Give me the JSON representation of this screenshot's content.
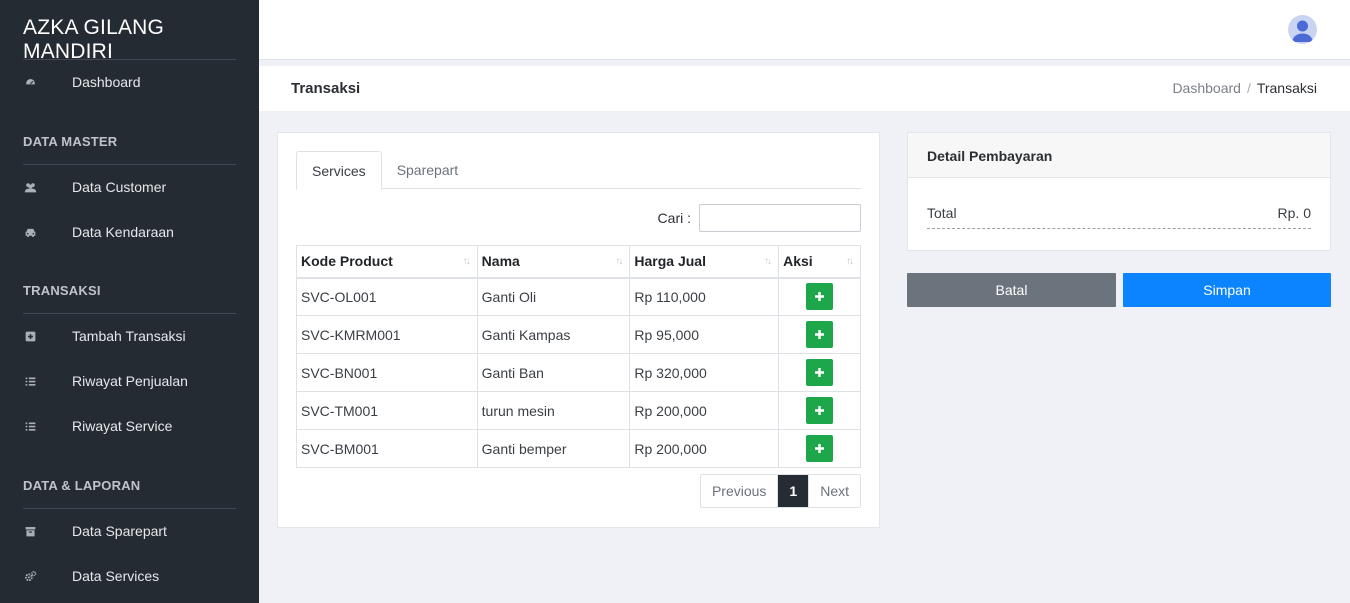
{
  "brand": "AZKA GILANG MANDIRI",
  "sidebar": {
    "dashboard": {
      "label": "Dashboard",
      "icon": "tachometer-icon"
    },
    "sections": [
      {
        "heading": "DATA MASTER",
        "items": [
          {
            "label": "Data Customer",
            "icon": "users-icon"
          },
          {
            "label": "Data Kendaraan",
            "icon": "car-icon"
          }
        ]
      },
      {
        "heading": "TRANSAKSI",
        "items": [
          {
            "label": "Tambah Transaksi",
            "icon": "plus-square-icon"
          },
          {
            "label": "Riwayat Penjualan",
            "icon": "list-icon"
          },
          {
            "label": "Riwayat Service",
            "icon": "list-icon"
          }
        ]
      },
      {
        "heading": "DATA & LAPORAN",
        "items": [
          {
            "label": "Data Sparepart",
            "icon": "archive-icon"
          },
          {
            "label": "Data Services",
            "icon": "cogs-icon"
          }
        ]
      }
    ]
  },
  "page": {
    "title": "Transaksi"
  },
  "breadcrumb": {
    "home": "Dashboard",
    "separator": "/",
    "current": "Transaksi"
  },
  "tabs": [
    {
      "label": "Services",
      "active": true
    },
    {
      "label": "Sparepart",
      "active": false
    }
  ],
  "search": {
    "label": "Cari :",
    "value": "",
    "placeholder": ""
  },
  "table": {
    "columns": [
      "Kode Product",
      "Nama",
      "Harga Jual",
      "Aksi"
    ],
    "rows": [
      {
        "kode": "SVC-OL001",
        "nama": "Ganti Oli",
        "harga": "Rp 110,000"
      },
      {
        "kode": "SVC-KMRM001",
        "nama": "Ganti Kampas",
        "harga": "Rp 95,000"
      },
      {
        "kode": "SVC-BN001",
        "nama": "Ganti Ban",
        "harga": "Rp 320,000"
      },
      {
        "kode": "SVC-TM001",
        "nama": "turun mesin",
        "harga": "Rp 200,000"
      },
      {
        "kode": "SVC-BM001",
        "nama": "Ganti bemper",
        "harga": "Rp 200,000"
      }
    ]
  },
  "pagination": {
    "previous": "Previous",
    "current": "1",
    "next": "Next"
  },
  "payment": {
    "title": "Detail Pembayaran",
    "total_label": "Total",
    "total_value": "Rp. 0"
  },
  "actions": {
    "cancel": "Batal",
    "save": "Simpan"
  },
  "colors": {
    "sidebar": "#252b33",
    "add_button": "#1ea64a",
    "save_button": "#0d84ff",
    "cancel_button": "#6b747d"
  }
}
